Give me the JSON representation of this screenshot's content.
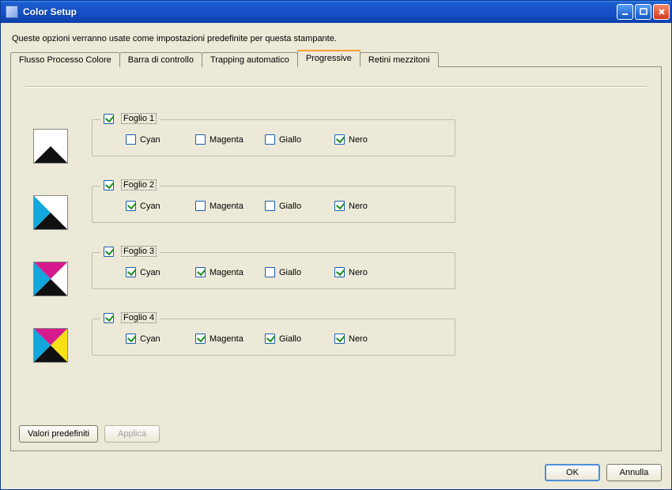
{
  "window": {
    "title": "Color Setup"
  },
  "description": "Queste opzioni verranno usate come impostazioni predefinite per questa stampante.",
  "tabs": {
    "t0": "Flusso Processo Colore",
    "t1": "Barra di controllo",
    "t2": "Trapping automatico",
    "t3": "Progressive",
    "t4": "Retini mezzitoni",
    "active_index": 3
  },
  "ink_labels": {
    "cyan": "Cyan",
    "magenta": "Magenta",
    "yellow": "Giallo",
    "black": "Nero"
  },
  "sheets": [
    {
      "legend": "Foglio 1",
      "enabled": true,
      "cyan": false,
      "magenta": false,
      "yellow": false,
      "black": true
    },
    {
      "legend": "Foglio 2",
      "enabled": true,
      "cyan": true,
      "magenta": false,
      "yellow": false,
      "black": true
    },
    {
      "legend": "Foglio 3",
      "enabled": true,
      "cyan": true,
      "magenta": true,
      "yellow": false,
      "black": true
    },
    {
      "legend": "Foglio 4",
      "enabled": true,
      "cyan": true,
      "magenta": true,
      "yellow": true,
      "black": true
    }
  ],
  "buttons": {
    "defaults": "Valori predefiniti",
    "apply": "Applica",
    "ok": "OK",
    "cancel": "Annulla"
  },
  "colors": {
    "cyan": "#12a7dc",
    "magenta": "#d61a8e",
    "yellow": "#f7e017",
    "black": "#101010"
  }
}
